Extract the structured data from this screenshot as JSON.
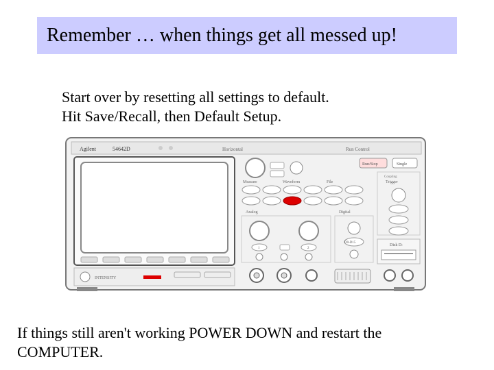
{
  "title": "Remember … when things get all messed up!",
  "instructions": {
    "line1": "Start over by resetting all settings to default.",
    "line2": "Hit Save/Recall, then Default Setup."
  },
  "footer": "If things still aren't working POWER DOWN and restart the COMPUTER.",
  "scope": {
    "brand": "Agilent",
    "model": "54642D",
    "labels": {
      "horizontal": "Horizontal",
      "runcontrol": "Run Control",
      "measure": "Measure",
      "waveform": "Waveform",
      "file": "File",
      "trigger": "Trigger",
      "analog": "Analog",
      "digital": "Digital",
      "coupling": "Coupling",
      "disk": "Disk D:",
      "intensity": "INTENSITY",
      "runstop": "Run/Stop",
      "single": "Single",
      "ch1": "1",
      "ch2": "2",
      "d0": "D0-D15"
    }
  }
}
